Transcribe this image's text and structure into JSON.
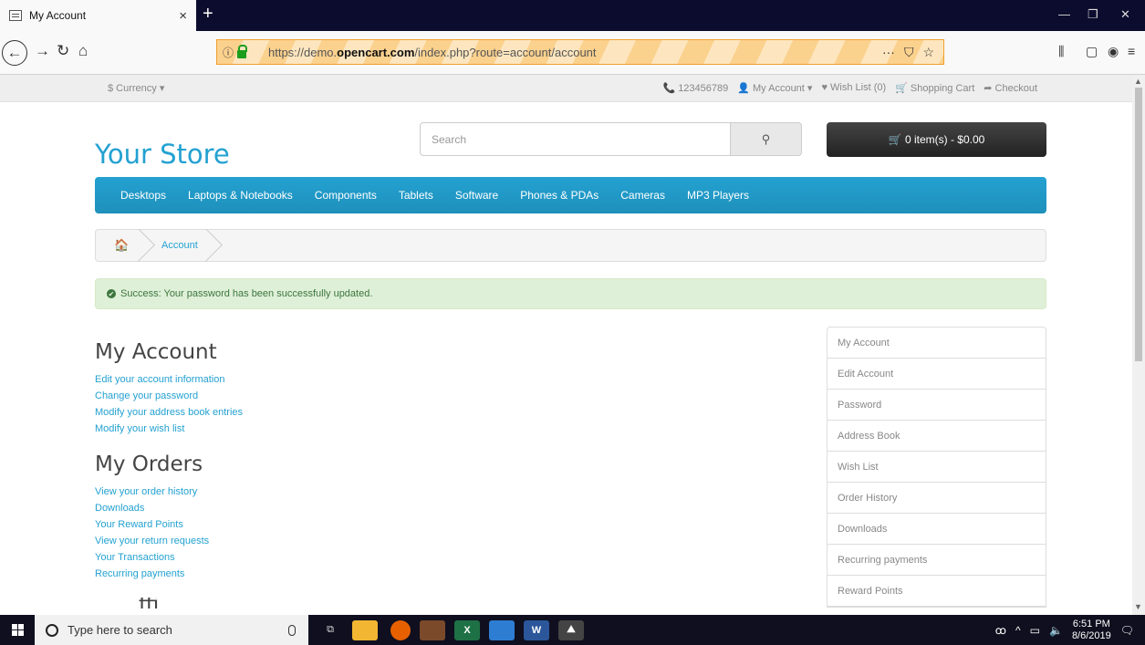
{
  "browser": {
    "tab_title": "My Account",
    "tab_close": "×",
    "new_tab": "+",
    "url_prefix": "https://demo.",
    "url_domain": "opencart.com",
    "url_suffix": "/index.php?route=account/account",
    "url_actions": [
      "···",
      "⛉",
      "☆"
    ],
    "window_controls": [
      "—",
      "❐",
      "✕"
    ]
  },
  "topbar": {
    "currency": "$ Currency ▾",
    "phone": "📞 123456789",
    "my_account": "👤 My Account ▾",
    "wishlist": "♥ Wish List (0)",
    "shopping_cart": "🛒 Shopping Cart",
    "checkout": "➦ Checkout"
  },
  "header": {
    "logo": "Your Store",
    "search_placeholder": "Search",
    "cart_label": "🛒 0 item(s) - $0.00"
  },
  "menu": [
    "Desktops",
    "Laptops & Notebooks",
    "Components",
    "Tablets",
    "Software",
    "Phones & PDAs",
    "Cameras",
    "MP3 Players"
  ],
  "breadcrumb": {
    "current": "Account"
  },
  "alert": {
    "text": "Success: Your password has been successfully updated."
  },
  "my_account": {
    "title": "My Account",
    "links": [
      "Edit your account information",
      "Change your password",
      "Modify your address book entries",
      "Modify your wish list"
    ]
  },
  "my_orders": {
    "title": "My Orders",
    "links": [
      "View your order history",
      "Downloads",
      "Your Reward Points",
      "View your return requests",
      "Your Transactions",
      "Recurring payments"
    ]
  },
  "cut_heading": "ffi",
  "sidebar": [
    "My Account",
    "Edit Account",
    "Password",
    "Address Book",
    "Wish List",
    "Order History",
    "Downloads",
    "Recurring payments",
    "Reward Points"
  ],
  "taskbar": {
    "search_text": "Type here to search",
    "time": "6:51 PM",
    "date": "8/6/2019"
  }
}
